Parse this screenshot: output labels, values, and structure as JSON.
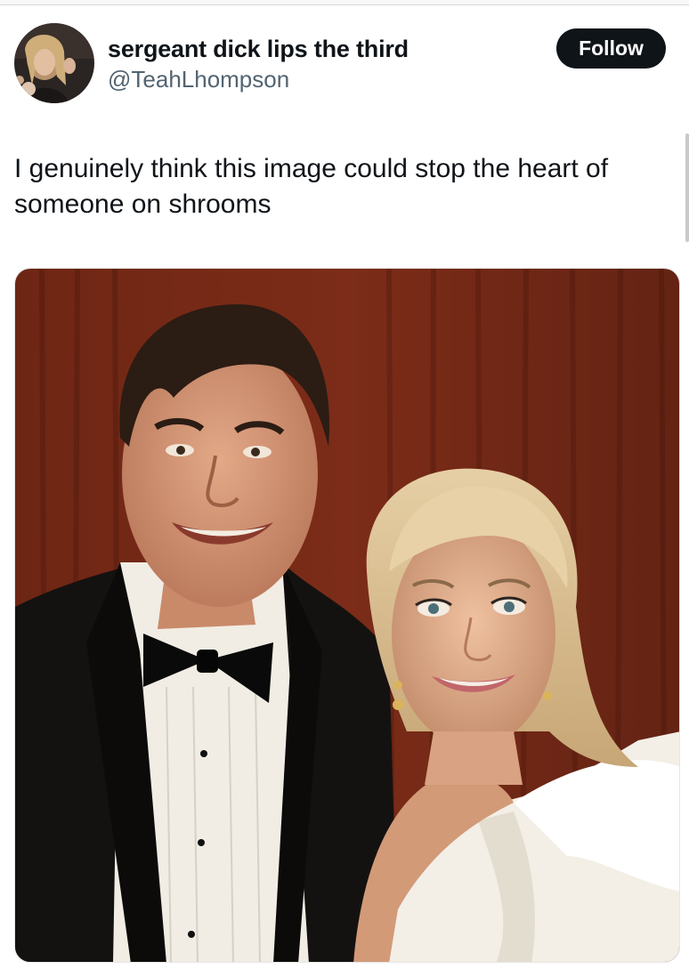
{
  "tweet": {
    "display_name": "sergeant dick lips the third",
    "handle": "@TeahLhompson",
    "follow_label": "Follow",
    "text": "I genuinely think this image could stop the heart of someone on shrooms"
  },
  "media": {
    "description_icon": "photo-icon"
  },
  "colors": {
    "text_primary": "#0f1419",
    "text_secondary": "#536471",
    "follow_bg": "#0f1419",
    "follow_text": "#ffffff",
    "background": "#ffffff"
  }
}
